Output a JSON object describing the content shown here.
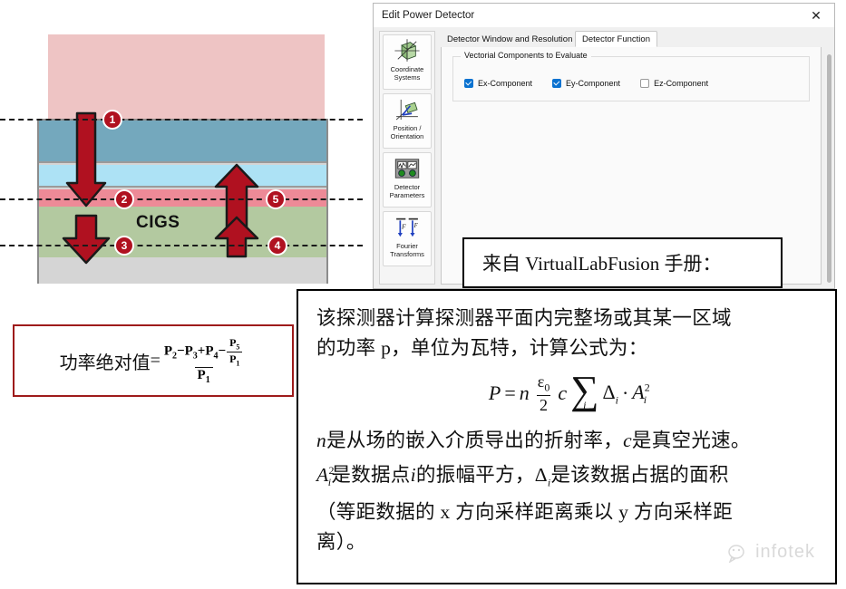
{
  "diagram": {
    "material_label": "CIGS",
    "badges": [
      {
        "n": "1"
      },
      {
        "n": "2"
      },
      {
        "n": "3"
      },
      {
        "n": "4"
      },
      {
        "n": "5"
      }
    ],
    "colors": {
      "pink_medium": "#eec4c4",
      "steel_blue": "#74a8bd",
      "light_blue": "#ade2f5",
      "salmon": "#ed8a97",
      "green_cigs": "#b3c9a0",
      "gray_substrate": "#d5d5d5",
      "arrow_red": "#b01120"
    }
  },
  "formula_box": {
    "label": "功率绝对值",
    "equals": "=",
    "numerator": {
      "p2": "P",
      "p2sub": "2",
      "minus": "−",
      "p3": "P",
      "p3sub": "3",
      "plus": "+",
      "p4": "P",
      "p4sub": "4",
      "minus2": "−",
      "inner_num": "P",
      "inner_num_sub": "5",
      "inner_den": "P",
      "inner_den_sub": "1"
    },
    "denominator": {
      "p1": "P",
      "p1sub": "1"
    },
    "border_color": "#9e1b1b"
  },
  "dialog": {
    "title": "Edit Power Detector",
    "close_label": "✕",
    "nav_items": [
      {
        "label_line1": "Coordinate",
        "label_line2": "Systems",
        "icon": "coordinate-systems-icon"
      },
      {
        "label_line1": "Position /",
        "label_line2": "Orientation",
        "icon": "position-orientation-icon"
      },
      {
        "label_line1": "Detector",
        "label_line2": "Parameters",
        "icon": "detector-parameters-icon"
      },
      {
        "label_line1": "Fourier",
        "label_line2": "Transforms",
        "icon": "fourier-transforms-icon"
      }
    ],
    "tabs": [
      {
        "label": "Detector Window and Resolution",
        "active": false
      },
      {
        "label": "Detector Function",
        "active": true
      }
    ],
    "group_legend": "Vectorial Components to Evaluate",
    "checkboxes": [
      {
        "label": "Ex-Component",
        "checked": true
      },
      {
        "label": "Ey-Component",
        "checked": true
      },
      {
        "label": "Ez-Component",
        "checked": false
      }
    ],
    "accent_color": "#0a72d0"
  },
  "source_box": {
    "text": "来自 VirtualLabFusion 手册："
  },
  "manual": {
    "line1": "该探测器计算探测器平面内完整场或其某一区域",
    "line2": "的功率 p，单位为瓦特，计算公式为：",
    "formula": {
      "P": "P",
      "eq": "=",
      "n": "n",
      "eps_num": "ε",
      "eps_num_sub": "0",
      "eps_den": "2",
      "c": "c",
      "sum": "∑",
      "sum_index": "i",
      "delta": "Δ",
      "delta_sub": "i",
      "dot": "·",
      "A": "A",
      "A_sub": "i",
      "A_sup": "2"
    },
    "line3_a": "n",
    "line3_b": "是从场的嵌入介质导出的折射率，",
    "line3_c": "c",
    "line3_d": "是真空光速。",
    "line4_a": "A",
    "line4_sub": "i",
    "line4_sup": "2",
    "line4_b": "是数据点",
    "line4_c": "i",
    "line4_d": "的振幅平方，",
    "line4_e": "Δ",
    "line4_esub": "i",
    "line4_f": "是该数据占据的面积",
    "line5": "（等距数据的 x 方向采样距离乘以 y 方向采样距",
    "line6": "离）。"
  },
  "watermark": {
    "text": "infotek"
  }
}
